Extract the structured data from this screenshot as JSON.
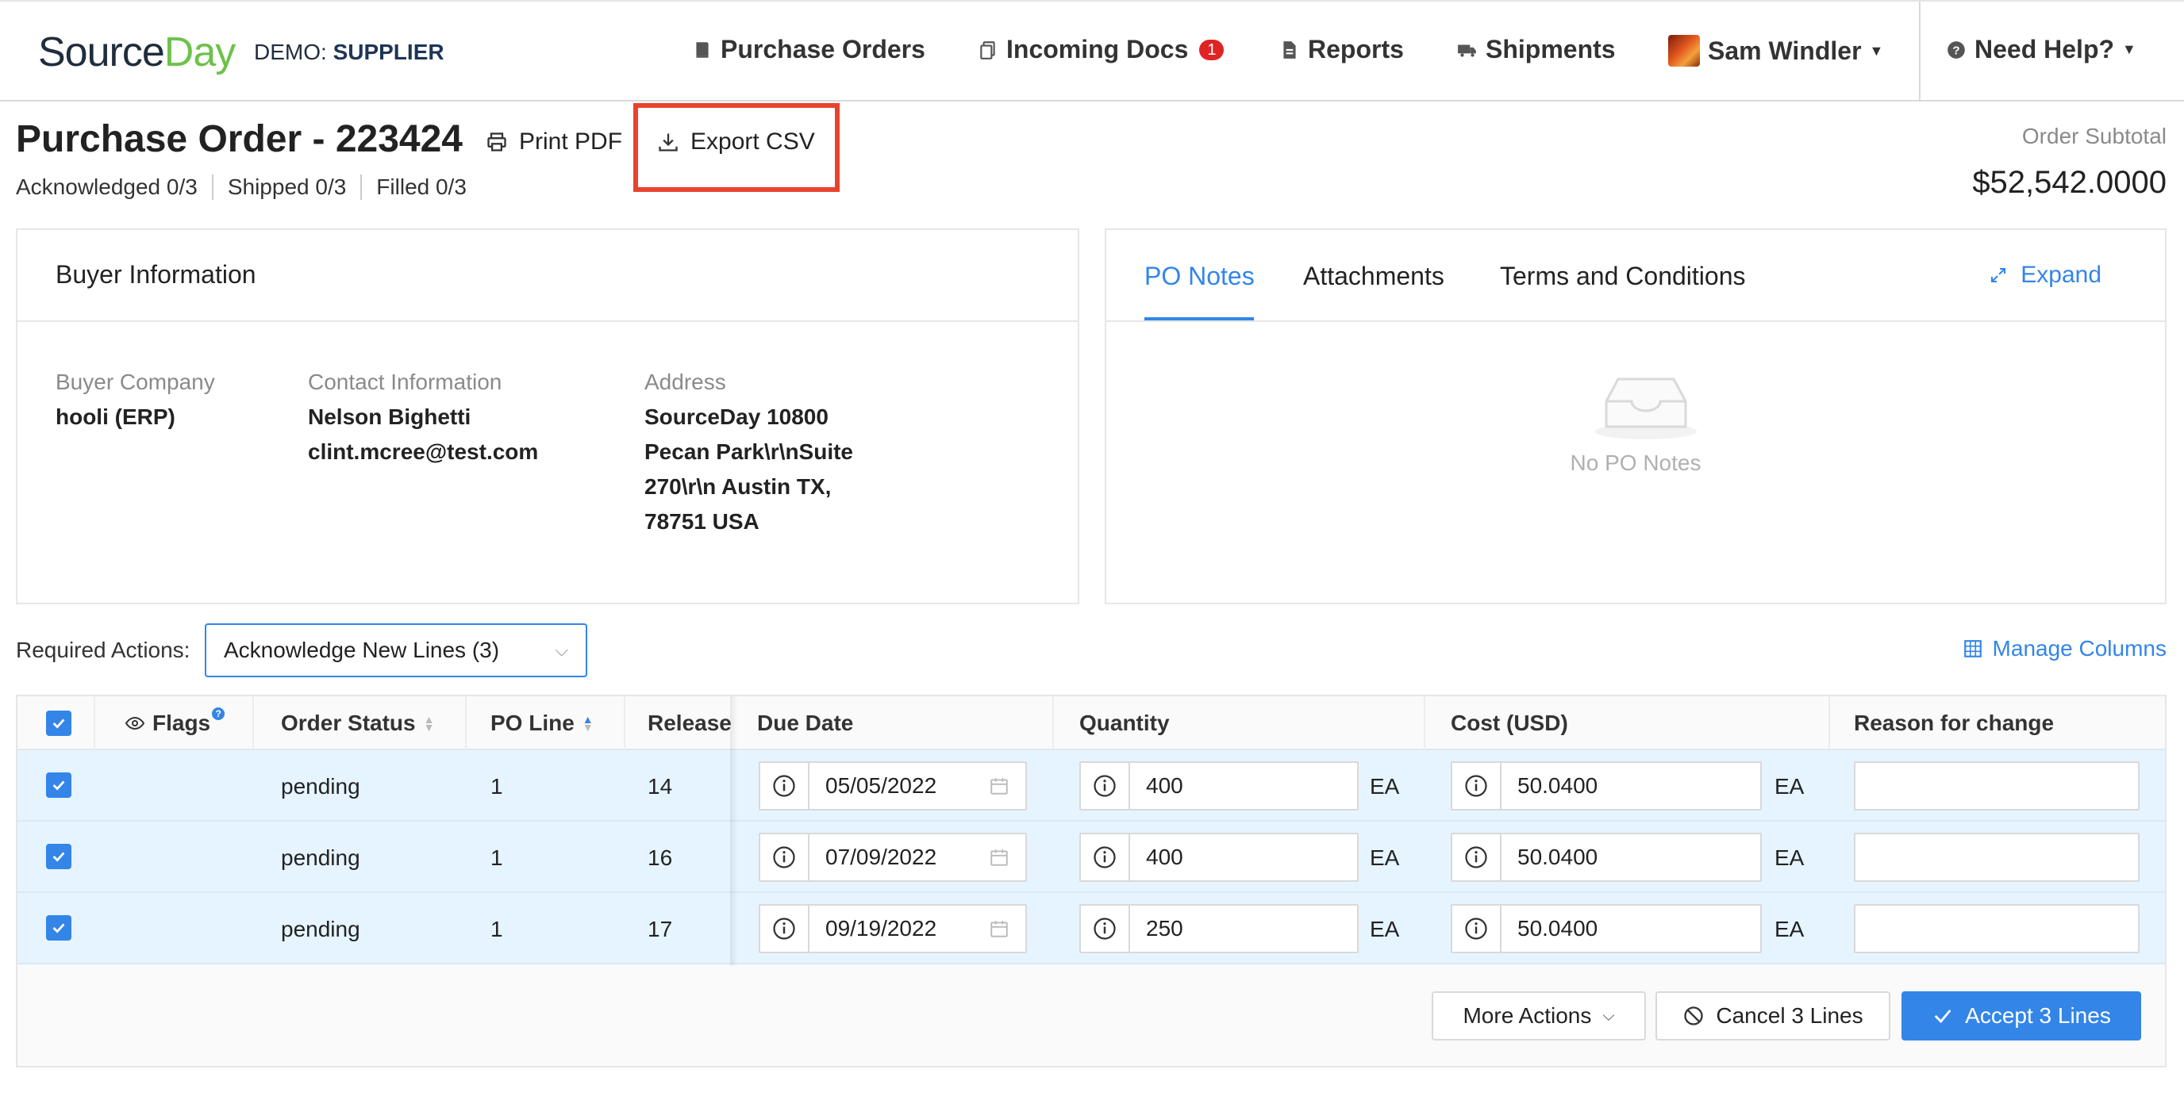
{
  "brand": {
    "logo_source": "Source",
    "logo_day": "Day",
    "demo_label": "DEMO:",
    "demo_role": "SUPPLIER"
  },
  "nav": {
    "purchase_orders": "Purchase Orders",
    "incoming_docs": "Incoming Docs",
    "incoming_docs_count": "1",
    "reports": "Reports",
    "shipments": "Shipments",
    "user_name": "Sam Windler",
    "need_help": "Need Help?"
  },
  "header": {
    "title": "Purchase Order - 223424",
    "print_pdf": "Print PDF",
    "export_csv": "Export CSV",
    "acknowledged": "Acknowledged 0/3",
    "shipped": "Shipped 0/3",
    "filled": "Filled 0/3",
    "subtotal_label": "Order Subtotal",
    "subtotal_value": "$52,542.0000"
  },
  "buyer": {
    "title": "Buyer Information",
    "company_label": "Buyer Company",
    "company": "hooli (ERP)",
    "contact_label": "Contact Information",
    "contact_name": "Nelson Bighetti",
    "contact_email": "clint.mcree@test.com",
    "address_label": "Address",
    "address_lines": [
      "SourceDay 10800",
      "Pecan Park\\r\\nSuite",
      "270\\r\\n Austin TX,",
      "78751 USA"
    ]
  },
  "notes_panel": {
    "tabs": [
      "PO Notes",
      "Attachments",
      "Terms and Conditions"
    ],
    "active_tab": "PO Notes",
    "expand": "Expand",
    "empty_text": "No PO Notes"
  },
  "actions": {
    "label": "Required Actions:",
    "selected": "Acknowledge New Lines (3)",
    "manage_columns": "Manage Columns"
  },
  "table": {
    "columns": [
      "Flags",
      "Order Status",
      "PO Line",
      "Release",
      "Due Date",
      "Quantity",
      "Cost (USD)",
      "Reason for change"
    ],
    "rows": [
      {
        "status": "pending",
        "po_line": "1",
        "release": "14",
        "due_date": "05/05/2022",
        "quantity": "400",
        "qty_unit": "EA",
        "cost": "50.0400",
        "cost_unit": "EA",
        "reason": ""
      },
      {
        "status": "pending",
        "po_line": "1",
        "release": "16",
        "due_date": "07/09/2022",
        "quantity": "400",
        "qty_unit": "EA",
        "cost": "50.0400",
        "cost_unit": "EA",
        "reason": ""
      },
      {
        "status": "pending",
        "po_line": "1",
        "release": "17",
        "due_date": "09/19/2022",
        "quantity": "250",
        "qty_unit": "EA",
        "cost": "50.0400",
        "cost_unit": "EA",
        "reason": ""
      }
    ]
  },
  "footer": {
    "more_actions": "More Actions",
    "cancel": "Cancel 3 Lines",
    "accept": "Accept 3 Lines"
  },
  "colors": {
    "accent": "#3385e8",
    "brand_green": "#6cc24a",
    "highlight_box": "#e8432f",
    "row_selected": "#e6f4ff",
    "badge": "#e02424"
  }
}
